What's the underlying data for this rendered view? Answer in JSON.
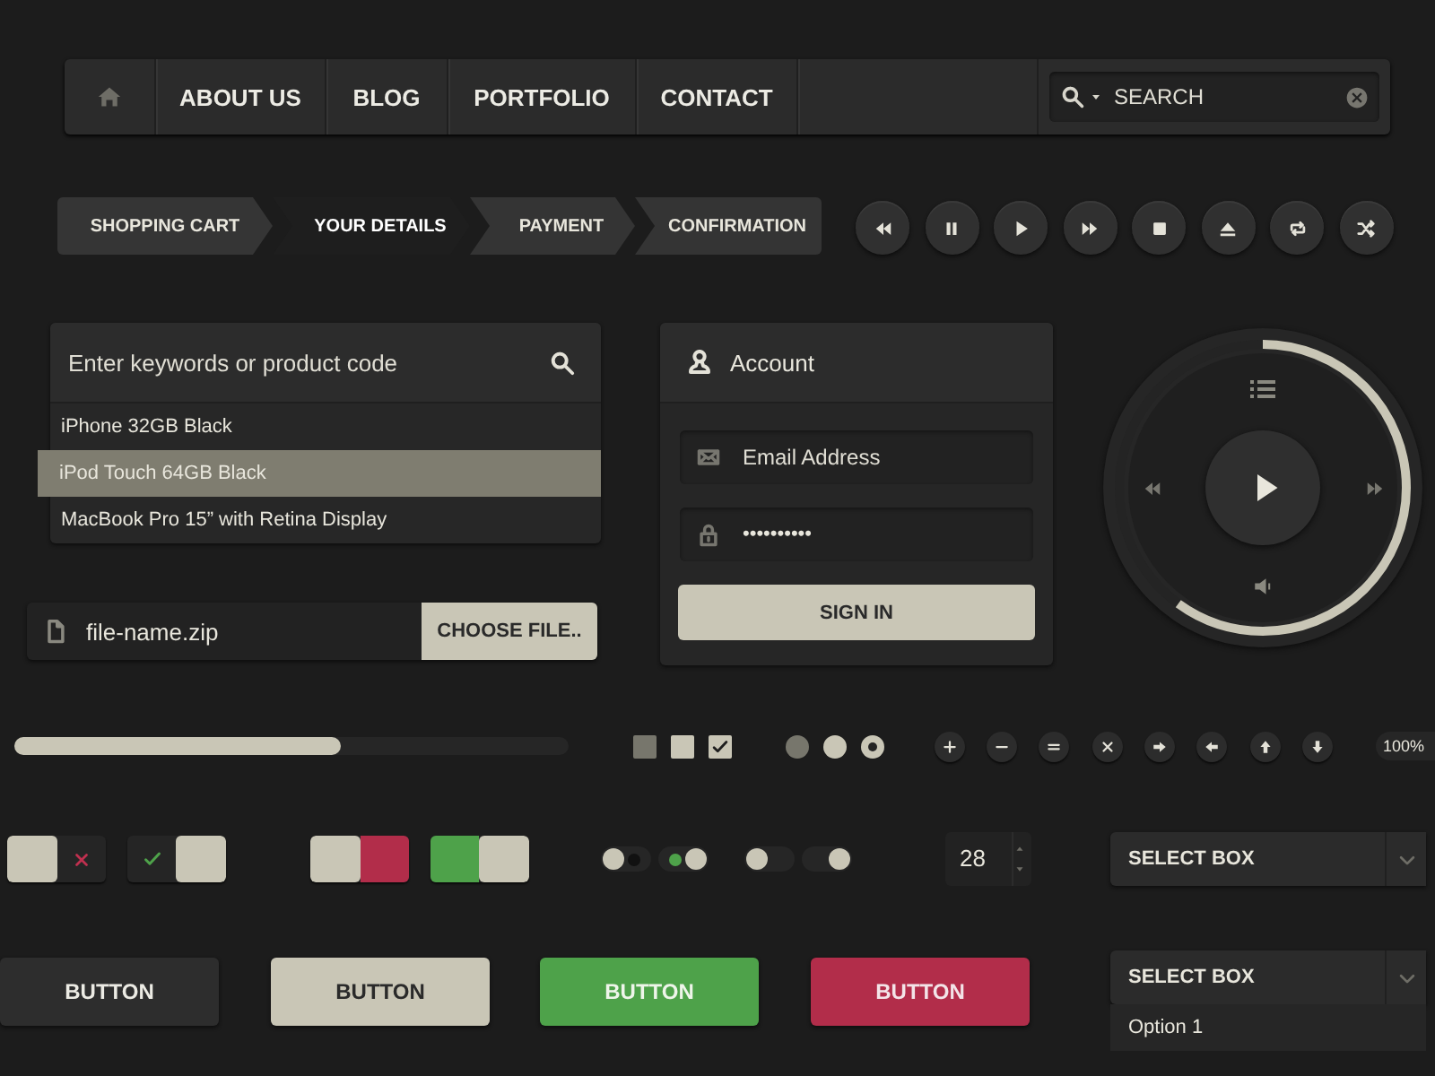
{
  "nav": {
    "items": [
      {
        "kind": "home"
      },
      {
        "kind": "text",
        "label": "ABOUT US"
      },
      {
        "kind": "text",
        "label": "BLOG"
      },
      {
        "kind": "text",
        "label": "PORTFOLIO"
      },
      {
        "kind": "text",
        "label": "CONTACT"
      }
    ],
    "search": {
      "placeholder": "SEARCH"
    }
  },
  "steps": [
    {
      "label": "SHOPPING CART",
      "selected": false
    },
    {
      "label": "YOUR DETAILS",
      "selected": true
    },
    {
      "label": "PAYMENT",
      "selected": false
    },
    {
      "label": "CONFIRMATION",
      "selected": false
    }
  ],
  "media_buttons": [
    {
      "kind": "rewind"
    },
    {
      "kind": "pause"
    },
    {
      "kind": "play"
    },
    {
      "kind": "fast-forward"
    },
    {
      "kind": "stop"
    },
    {
      "kind": "eject"
    },
    {
      "kind": "repeat"
    },
    {
      "kind": "shuffle"
    }
  ],
  "product_search": {
    "placeholder": "Enter keywords or product code",
    "results": [
      {
        "label": "iPhone 32GB Black",
        "selected": false
      },
      {
        "label": "iPod Touch 64GB Black",
        "selected": true
      },
      {
        "label": "MacBook Pro 15” with Retina Display",
        "selected": false
      }
    ]
  },
  "file_input": {
    "value": "file-name.zip",
    "button": "CHOOSE FILE.."
  },
  "account": {
    "title": "Account",
    "email_placeholder": "Email Address",
    "password": "••••••••••",
    "button": "SIGN IN"
  },
  "player": {
    "level": 0.6
  },
  "progress": {
    "level": 0.59
  },
  "checkboxes": [
    {
      "checked": false,
      "disabled": true
    },
    {
      "checked": false,
      "disabled": false
    },
    {
      "checked": true,
      "disabled": false
    }
  ],
  "radios": [
    {
      "selected": false,
      "disabled": true
    },
    {
      "selected": false,
      "disabled": false
    },
    {
      "selected": true,
      "disabled": false
    }
  ],
  "icon_buttons": [
    {
      "kind": "plus"
    },
    {
      "kind": "minus"
    },
    {
      "kind": "equals"
    },
    {
      "kind": "close"
    },
    {
      "kind": "arrow-right"
    },
    {
      "kind": "arrow-left"
    },
    {
      "kind": "arrow-up"
    },
    {
      "kind": "arrow-down"
    }
  ],
  "zoom_badge": "100%",
  "switches": [
    {
      "kind": "icon",
      "on": false
    },
    {
      "kind": "icon",
      "on": true
    },
    {
      "kind": "color",
      "on": false
    },
    {
      "kind": "color",
      "on": true
    }
  ],
  "mini_switches": [
    {
      "kind": "dot",
      "on": false
    },
    {
      "kind": "dot",
      "on": true
    },
    {
      "kind": "plain",
      "on": false
    },
    {
      "kind": "plain",
      "on": true
    }
  ],
  "spinner": {
    "value": "28"
  },
  "select": {
    "label": "SELECT BOX"
  },
  "buttons": [
    {
      "kind": "dark",
      "label": "BUTTON"
    },
    {
      "kind": "light",
      "label": "BUTTON"
    },
    {
      "kind": "green",
      "label": "BUTTON"
    },
    {
      "kind": "red",
      "label": "BUTTON"
    }
  ],
  "open_select": {
    "label": "SELECT BOX",
    "options": [
      "Option 1"
    ]
  }
}
